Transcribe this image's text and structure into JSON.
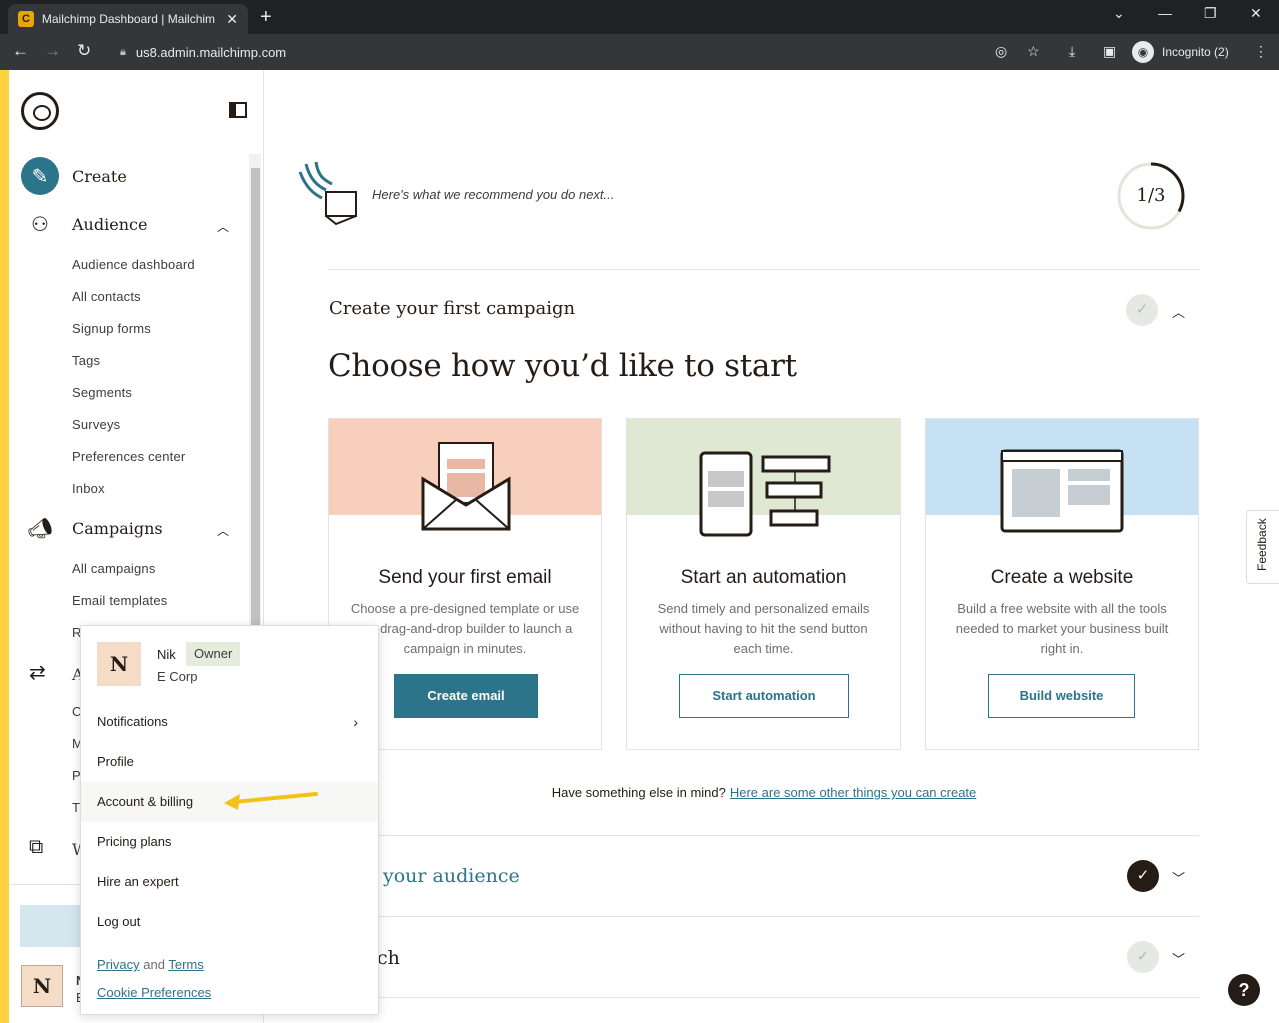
{
  "browser": {
    "tab_title": "Mailchimp Dashboard | Mailchim",
    "url": "us8.admin.mailchimp.com",
    "profile_label": "Incognito (2)"
  },
  "sidebar": {
    "nav": [
      {
        "label": "Create",
        "icon": "pencil-icon"
      },
      {
        "label": "Audience",
        "icon": "audience-icon"
      },
      {
        "label": "Campaigns",
        "icon": "megaphone-icon"
      }
    ],
    "audience_items": [
      "Audience dashboard",
      "All contacts",
      "Signup forms",
      "Tags",
      "Segments",
      "Surveys",
      "Preferences center",
      "Inbox"
    ],
    "campaign_items": [
      "All campaigns",
      "Email templates"
    ],
    "obscured_letters": [
      "R",
      "A",
      "C",
      "M",
      "P",
      "T",
      "W"
    ],
    "avatar_letter": "N",
    "footer_letters": [
      "N",
      "E"
    ]
  },
  "main": {
    "recommend_text": "Here's what we recommend you do next...",
    "progress": "1/3",
    "progress_fraction": 0.33,
    "step1_title": "Create your first campaign",
    "headline": "Choose how you’d like to start",
    "cards": [
      {
        "title": "Send your first email",
        "desc": "Choose a pre-designed template or use our drag-and-drop builder to launch a campaign in minutes.",
        "button": "Create email",
        "band_color": "#f8cfbc"
      },
      {
        "title": "Start an automation",
        "desc": "Send timely and personalized emails without having to hit the send button each time.",
        "button": "Start automation",
        "band_color": "#dee8d3"
      },
      {
        "title": "Create a website",
        "desc": "Build a free website with all the tools needed to market your business built right in.",
        "button": "Build website",
        "band_color": "#c6e0f4"
      }
    ],
    "other_prefix": "Have something else in mind?",
    "other_link": "Here are some other things you can create",
    "step2_title": "your audience",
    "step3_title": "ch",
    "feedback_label": "Feedback",
    "help_label": "?"
  },
  "popup": {
    "avatar_letter": "N",
    "name": "Nik",
    "role": "Owner",
    "company": "E Corp",
    "items": [
      "Notifications",
      "Profile",
      "Account & billing",
      "Pricing plans",
      "Hire an expert",
      "Log out"
    ],
    "privacy": "Privacy",
    "and": "and",
    "terms": "Terms",
    "cookie": "Cookie Preferences"
  },
  "colors": {
    "accent": "#ffd23f",
    "brand_teal": "#2b7489",
    "arrow": "#f2c21b"
  }
}
